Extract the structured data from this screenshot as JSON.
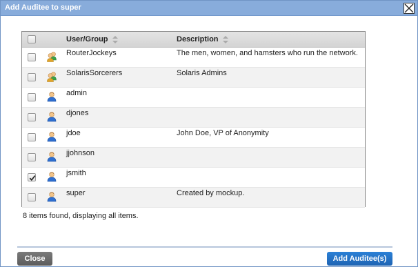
{
  "dialog": {
    "title": "Add Auditee to super"
  },
  "grid": {
    "columns": [
      "User/Group",
      "Description"
    ],
    "rows": [
      {
        "name": "RouterJockeys",
        "description": "The men, women, and hamsters who run the network.",
        "type": "group",
        "checked": false
      },
      {
        "name": "SolarisSorcerers",
        "description": "Solaris Admins",
        "type": "group",
        "checked": false
      },
      {
        "name": "admin",
        "description": "",
        "type": "user",
        "checked": false
      },
      {
        "name": "djones",
        "description": "",
        "type": "user",
        "checked": false
      },
      {
        "name": "jdoe",
        "description": "John Doe, VP of Anonymity",
        "type": "user",
        "checked": false
      },
      {
        "name": "jjohnson",
        "description": "",
        "type": "user",
        "checked": false
      },
      {
        "name": "jsmith",
        "description": "",
        "type": "user",
        "checked": true
      },
      {
        "name": "super",
        "description": "Created by mockup.",
        "type": "user",
        "checked": false
      }
    ]
  },
  "status": {
    "count_text": "8 items found, displaying all items."
  },
  "buttons": {
    "close_label": "Close",
    "add_label": "Add Auditee(s)"
  },
  "colors": {
    "titlebar": "#88acdb",
    "primary_button": "#1e64b3",
    "secondary_button": "#5c5c5c"
  }
}
